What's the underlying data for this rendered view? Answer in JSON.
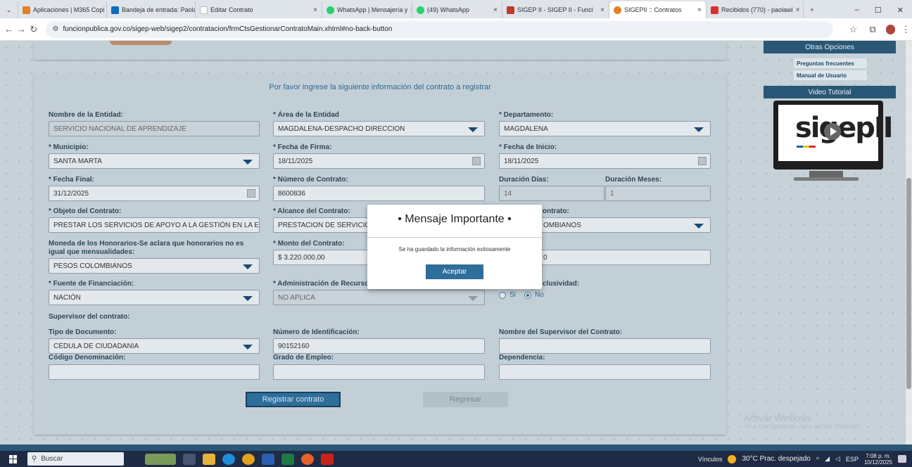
{
  "browser": {
    "tabs": [
      {
        "label": "Aplicaciones | M365 Copi",
        "color": "#e67e22"
      },
      {
        "label": "Bandeja de entrada: Paola",
        "color": "#0f6cbd"
      },
      {
        "label": "Editar Contrato",
        "color": "#ffffff"
      },
      {
        "label": "WhatsApp | Mensajería y",
        "color": "#25d366"
      },
      {
        "label": "(49) WhatsApp",
        "color": "#25d366"
      },
      {
        "label": "SIGEP II - SIGEP II - Funci",
        "color": "#c0392b"
      },
      {
        "label": "SIGEPII :: Contratos",
        "color": "#e67e22"
      },
      {
        "label": "Recibidos (770) - paolawl",
        "color": "#d93025"
      }
    ],
    "url": "funcionpublica.gov.co/sigep-web/sigep2/contratacion/frmCtsGestionarContratoMain.xhtml#no-back-button"
  },
  "sidebar": {
    "otras_opciones": "Otras Opciones",
    "links": [
      "Preguntas frecuentes",
      "Manual de Usuario"
    ],
    "video_tutorial": "Video Tutorial",
    "logo_text": "sigepII"
  },
  "form": {
    "title": "Por favor ingrese la siguiente información del contrato a registrar",
    "nombre_entidad": {
      "label": "Nombre de la Entidad:",
      "value": "SERVICIO NACIONAL DE APRENDIZAJE"
    },
    "area_entidad": {
      "label": "* Área de la Entidad",
      "value": "MAGDALENA-DESPACHO DIRECCION"
    },
    "departamento": {
      "label": "* Departamento:",
      "value": "MAGDALENA"
    },
    "municipio": {
      "label": "* Municipio:",
      "value": "SANTA MARTA"
    },
    "fecha_firma": {
      "label": "* Fecha de Firma:",
      "value": "18/11/2025"
    },
    "fecha_inicio": {
      "label": "* Fecha de Inicio:",
      "value": "18/11/2025"
    },
    "fecha_final": {
      "label": "* Fecha Final:",
      "value": "31/12/2025"
    },
    "numero_contrato": {
      "label": "* Número de Contrato:",
      "value": "8600836"
    },
    "duracion_dias": {
      "label": "Duración Días:",
      "value": "14"
    },
    "duracion_meses": {
      "label": "Duración Meses:",
      "value": "1"
    },
    "objeto": {
      "label": "* Objeto del Contrato:",
      "value": "PRESTAR LOS SERVICIOS DE APOYO A LA GESTIÓN EN LA ETAPA"
    },
    "alcance": {
      "label": "* Alcance del Contrato:",
      "value": "PRESTACION DE SERVICIO"
    },
    "moneda_contrato": {
      "label": "ontrato:",
      "value": "OMBIANOS"
    },
    "moneda_honorarios": {
      "label": "Moneda de los Honorarios-Se aclara que honorarios no es igual que mensualidades:",
      "value": "PESOS COLOMBIANOS"
    },
    "monto": {
      "label": "* Monto del Contrato:",
      "value": "$ 3.220.000,00"
    },
    "honorarios_partial": {
      "value": "0"
    },
    "fuente": {
      "label": "* Fuente de Financiación:",
      "value": "NACIÓN"
    },
    "administracion": {
      "label": "* Administración de Recursos:",
      "value": "NO APLICA"
    },
    "exclusividad": {
      "label": "clusividad:",
      "si": "Si",
      "no": "No"
    },
    "supervisor_heading": "Supervisor del contrato:",
    "tipo_documento": {
      "label": "Tipo de Documento:",
      "value": "CEDULA DE CIUDADANIA"
    },
    "numero_identificacion": {
      "label": "Número de Identificación:",
      "value": "90152160"
    },
    "nombre_supervisor": {
      "label": "Nombre del Supervisor del Contrato:",
      "value": ""
    },
    "codigo_denominacion": {
      "label": "Código Denominación:",
      "value": ""
    },
    "grado_empleo": {
      "label": "Grado de Empleo:",
      "value": ""
    },
    "dependencia": {
      "label": "Dependencia:",
      "value": ""
    },
    "btn_registrar": "Registrar contrato",
    "btn_regresar": "Regresar"
  },
  "modal": {
    "title": "• Mensaje Importante •",
    "message": "Se ha guardado la información exitosamente",
    "ok": "Aceptar"
  },
  "watermark": {
    "line1": "Activar Windows",
    "line2": "Ve a Configuración para activar Windows."
  },
  "taskbar": {
    "search": "Buscar",
    "vinculos": "Vínculos",
    "weather": "30°C  Prac. despejado",
    "lang": "ESP",
    "time": "7:08 p. m.",
    "date": "10/12/2025"
  }
}
